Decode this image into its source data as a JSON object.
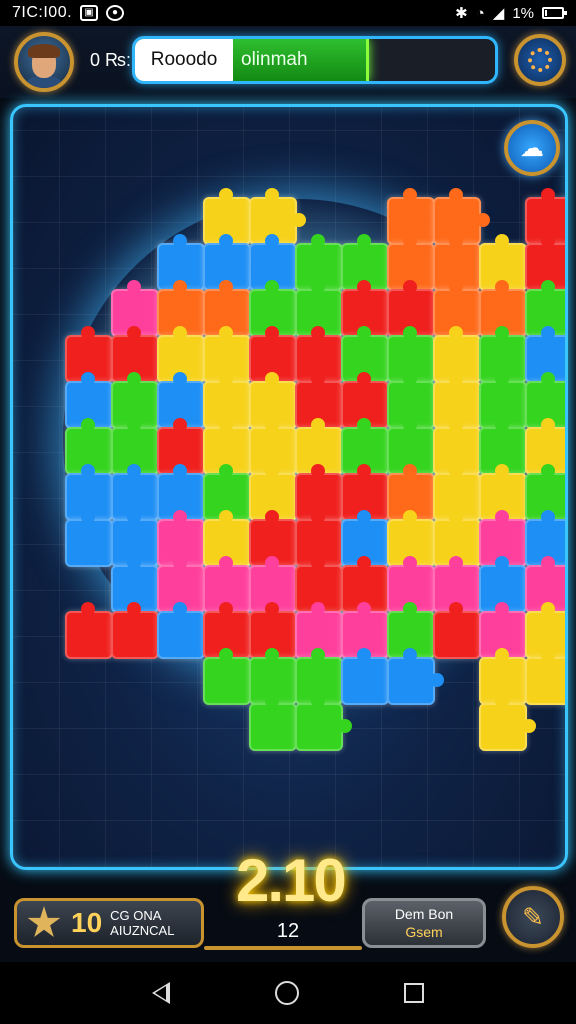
{
  "status_bar": {
    "time": "7IC:I00.",
    "right_text": "1%",
    "battery_level": 0.1,
    "icons": [
      "image-icon",
      "notification-icon",
      "bluetooth-icon",
      "wifi-icon",
      "signal-icon",
      "battery-icon"
    ]
  },
  "hud": {
    "small_label": "0 ₨:",
    "progress_label": "Rooodo",
    "progress_sub": "olinmah",
    "progress_fraction": 0.65,
    "avatar_icon": "player-avatar",
    "settings_icon": "settings-gear-icon",
    "hint_icon": "hint-icon"
  },
  "board": {
    "colors": {
      "red": "#f0201e",
      "green": "#35d41f",
      "yellow": "#f7d21a",
      "orange": "#ff6a1a",
      "blue": "#1d8ff5",
      "pink": "#ff3f9c",
      "glow": "#39c6ff"
    },
    "grid": [
      "....YY..OO.RR...",
      "...BBBGGOOYRR...",
      "..POOGGRROOGGG..",
      ".RRYYRRGGYGBBGG.",
      ".BGBYYRRGYGGRRR.",
      ".GGRYYYGGYGYYGG.",
      ".BBBGYRROYYGGG..",
      ".BBPYRRBYYPBBG..",
      "..BPPPRRPPBPPB..",
      ".RRBRRPPGRPYRRY.",
      "....GGGBB.YY....",
      ".....GG...Y....."
    ]
  },
  "bottom": {
    "timer": "2.10",
    "moves": "12",
    "left_button": {
      "count": "10",
      "line1": "CG ONA",
      "line2": "AIUZNCAL"
    },
    "right_button": {
      "line1": "Dem Bon",
      "line2": "Gsem"
    },
    "magic_icon": "magic-wand-icon"
  },
  "nav": {
    "icons": [
      "back-icon",
      "home-icon",
      "recents-icon"
    ]
  }
}
